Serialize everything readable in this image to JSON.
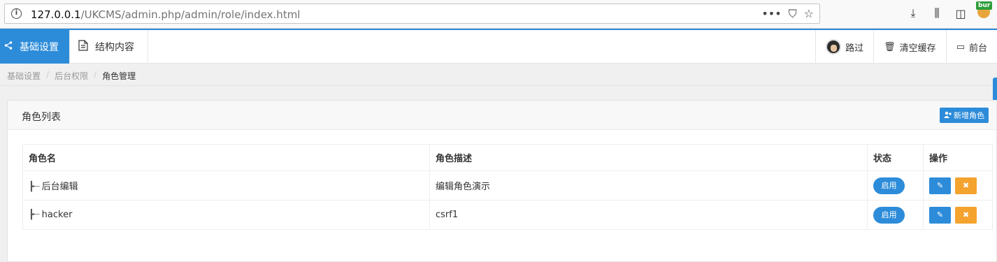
{
  "browser": {
    "url_host": "127.0.0.1",
    "url_path": "/UKCMS/admin.php/admin/role/index.html",
    "extension_badge": "bur"
  },
  "nav": {
    "left": [
      {
        "label": "基础设置",
        "icon": "share-icon"
      },
      {
        "label": "结构内容",
        "icon": "document-icon"
      }
    ],
    "user_name": "路过",
    "clear_cache": "清空缓存",
    "frontend": "前台"
  },
  "breadcrumb": [
    "基础设置",
    "后台权限",
    "角色管理"
  ],
  "panel": {
    "title": "角色列表",
    "add_button": "新增角色"
  },
  "table": {
    "headers": [
      "角色名",
      "角色描述",
      "状态",
      "操作"
    ],
    "tree_prefix": "┣┈",
    "rows": [
      {
        "name": "后台编辑",
        "desc": "编辑角色演示",
        "status": "启用"
      },
      {
        "name": "hacker",
        "desc": "csrf1",
        "status": "启用"
      }
    ]
  },
  "colors": {
    "primary": "#2d8cd9",
    "warning": "#f4a32e"
  }
}
